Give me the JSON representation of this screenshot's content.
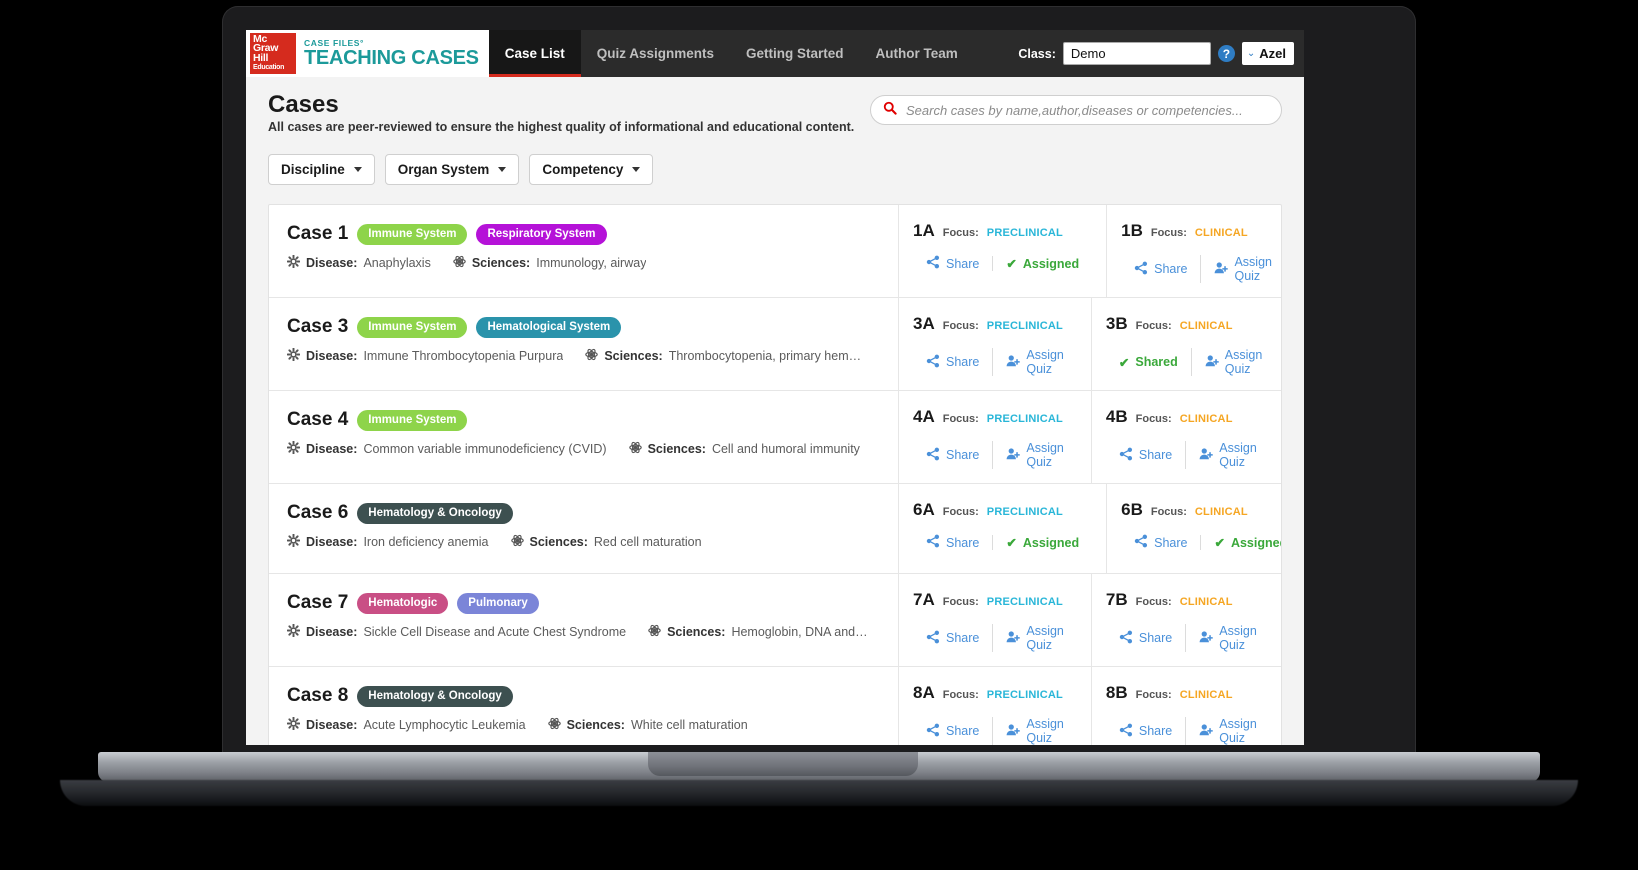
{
  "brand": {
    "mcgraw_line1": "Mc",
    "mcgraw_line2": "Graw",
    "mcgraw_line3": "Hill",
    "mcgraw_line4": "Education",
    "product_sub": "CASE FILES°",
    "product_main": "TEACHING CASES"
  },
  "nav": {
    "tabs": [
      {
        "label": "Case List",
        "active": true
      },
      {
        "label": "Quiz Assignments",
        "active": false
      },
      {
        "label": "Getting Started",
        "active": false
      },
      {
        "label": "Author Team",
        "active": false
      }
    ],
    "class_label": "Class:",
    "class_value": "Demo",
    "help_glyph": "?",
    "user_name": "Azel",
    "user_caret": "⌄"
  },
  "header": {
    "title": "Cases",
    "subtitle": "All cases are peer-reviewed to ensure the highest quality of informational and educational content."
  },
  "search": {
    "placeholder": "Search cases by name,author,diseases or competencies...",
    "value": ""
  },
  "filters": [
    {
      "label": "Discipline"
    },
    {
      "label": "Organ System"
    },
    {
      "label": "Competency"
    }
  ],
  "labels": {
    "disease": "Disease:",
    "sciences": "Sciences:",
    "focus": "Focus:",
    "share": "Share",
    "assign_quiz": "Assign Quiz",
    "assigned": "Assigned",
    "shared": "Shared",
    "check": "✔"
  },
  "colors": {
    "immune_system": "#8ed44a",
    "respiratory_system": "#b512d8",
    "hematological_system": "#2a93ab",
    "hematology_oncology": "#3d5050",
    "hematologic": "#c94f85",
    "pulmonary": "#7b85d8",
    "preclinical": "#29b6d8",
    "clinical": "#f5a623",
    "link": "#4a90d9",
    "status_green": "#3aa83a",
    "brand_red": "#d52b1e",
    "brand_teal": "#1c9a9a"
  },
  "rows": [
    {
      "case": "Case 1",
      "badges": [
        {
          "label": "Immune System",
          "color": "#8ed44a"
        },
        {
          "label": "Respiratory System",
          "color": "#b512d8"
        }
      ],
      "disease": "Anaphylaxis",
      "sciences": "Immunology, airway",
      "quizzes": [
        {
          "id": "1A",
          "focus": "PRECLINICAL",
          "focus_type": "preclinical",
          "actions": [
            {
              "type": "share",
              "label": "Share"
            },
            {
              "type": "status",
              "label": "Assigned"
            }
          ]
        },
        {
          "id": "1B",
          "focus": "CLINICAL",
          "focus_type": "clinical",
          "actions": [
            {
              "type": "share",
              "label": "Share"
            },
            {
              "type": "assign",
              "label": "Assign Quiz"
            }
          ]
        }
      ]
    },
    {
      "case": "Case 3",
      "badges": [
        {
          "label": "Immune System",
          "color": "#8ed44a"
        },
        {
          "label": "Hematological System",
          "color": "#2a93ab"
        }
      ],
      "disease": "Immune Thrombocytopenia Purpura",
      "sciences": "Thrombocytopenia, primary hem…",
      "quizzes": [
        {
          "id": "3A",
          "focus": "PRECLINICAL",
          "focus_type": "preclinical",
          "actions": [
            {
              "type": "share",
              "label": "Share"
            },
            {
              "type": "assign",
              "label": "Assign Quiz"
            }
          ]
        },
        {
          "id": "3B",
          "focus": "CLINICAL",
          "focus_type": "clinical",
          "actions": [
            {
              "type": "status",
              "label": "Shared"
            },
            {
              "type": "assign",
              "label": "Assign Quiz"
            }
          ]
        }
      ]
    },
    {
      "case": "Case 4",
      "badges": [
        {
          "label": "Immune System",
          "color": "#8ed44a"
        }
      ],
      "disease": "Common variable immunodeficiency (CVID)",
      "sciences": "Cell and humoral immunity",
      "quizzes": [
        {
          "id": "4A",
          "focus": "PRECLINICAL",
          "focus_type": "preclinical",
          "actions": [
            {
              "type": "share",
              "label": "Share"
            },
            {
              "type": "assign",
              "label": "Assign Quiz"
            }
          ]
        },
        {
          "id": "4B",
          "focus": "CLINICAL",
          "focus_type": "clinical",
          "actions": [
            {
              "type": "share",
              "label": "Share"
            },
            {
              "type": "assign",
              "label": "Assign Quiz"
            }
          ]
        }
      ]
    },
    {
      "case": "Case 6",
      "badges": [
        {
          "label": "Hematology & Oncology",
          "color": "#3d5050"
        }
      ],
      "disease": "Iron deficiency anemia",
      "sciences": "Red cell maturation",
      "quizzes": [
        {
          "id": "6A",
          "focus": "PRECLINICAL",
          "focus_type": "preclinical",
          "actions": [
            {
              "type": "share",
              "label": "Share"
            },
            {
              "type": "status",
              "label": "Assigned"
            }
          ]
        },
        {
          "id": "6B",
          "focus": "CLINICAL",
          "focus_type": "clinical",
          "actions": [
            {
              "type": "share",
              "label": "Share"
            },
            {
              "type": "status",
              "label": "Assigned"
            }
          ]
        }
      ]
    },
    {
      "case": "Case 7",
      "badges": [
        {
          "label": "Hematologic",
          "color": "#c94f85"
        },
        {
          "label": "Pulmonary",
          "color": "#7b85d8"
        }
      ],
      "disease": "Sickle Cell Disease and Acute Chest Syndrome",
      "sciences": "Hemoglobin, DNA and…",
      "quizzes": [
        {
          "id": "7A",
          "focus": "PRECLINICAL",
          "focus_type": "preclinical",
          "actions": [
            {
              "type": "share",
              "label": "Share"
            },
            {
              "type": "assign",
              "label": "Assign Quiz"
            }
          ]
        },
        {
          "id": "7B",
          "focus": "CLINICAL",
          "focus_type": "clinical",
          "actions": [
            {
              "type": "share",
              "label": "Share"
            },
            {
              "type": "assign",
              "label": "Assign Quiz"
            }
          ]
        }
      ]
    },
    {
      "case": "Case 8",
      "badges": [
        {
          "label": "Hematology & Oncology",
          "color": "#3d5050"
        }
      ],
      "disease": "Acute Lymphocytic Leukemia",
      "sciences": "White cell maturation",
      "quizzes": [
        {
          "id": "8A",
          "focus": "PRECLINICAL",
          "focus_type": "preclinical",
          "actions": [
            {
              "type": "share",
              "label": "Share"
            },
            {
              "type": "assign",
              "label": "Assign Quiz"
            }
          ]
        },
        {
          "id": "8B",
          "focus": "CLINICAL",
          "focus_type": "clinical",
          "actions": [
            {
              "type": "share",
              "label": "Share"
            },
            {
              "type": "assign",
              "label": "Assign Quiz"
            }
          ]
        }
      ]
    }
  ]
}
